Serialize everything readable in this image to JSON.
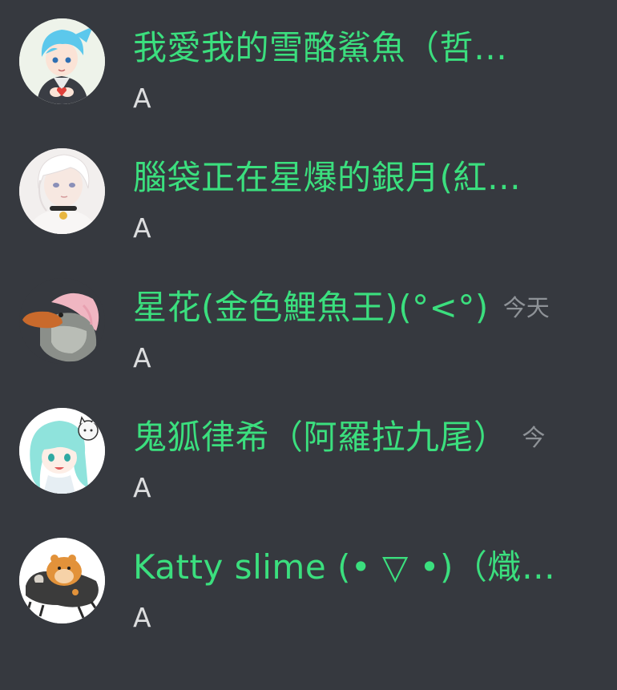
{
  "colors": {
    "background": "#36393f",
    "username": "#3bdf7e",
    "message_text": "#dcddde",
    "timestamp": "#8e9297"
  },
  "messages": [
    {
      "username": "我愛我的雪酪鯊魚（哲…",
      "timestamp": "",
      "content": "A",
      "avatar": "blue-haired-boy-holding-heart"
    },
    {
      "username": "腦袋正在星爆的銀月(紅…",
      "timestamp": "",
      "content": "A",
      "avatar": "white-haired-person-with-bell-collar"
    },
    {
      "username": "星花(金色鯉魚王)(°<°)",
      "timestamp": "今天",
      "content": "A",
      "avatar": "platypus-with-pink-haired-character"
    },
    {
      "username": "鬼狐律希（阿羅拉九尾）",
      "timestamp": "今",
      "content": "A",
      "avatar": "mint-haired-character-with-cat"
    },
    {
      "username": "Katty slime (• ▽ •)（熾…",
      "timestamp": "",
      "content": "A",
      "avatar": "hamster-and-ferret"
    }
  ]
}
